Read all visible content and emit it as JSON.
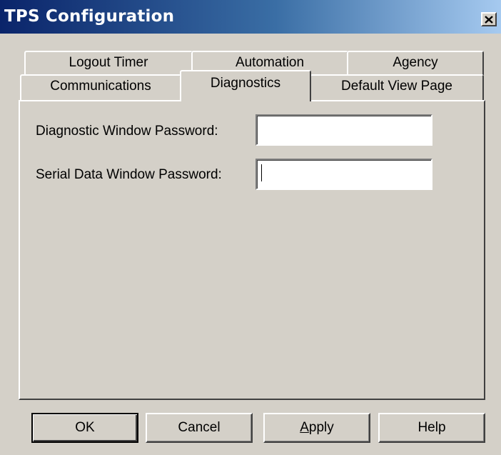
{
  "window": {
    "title": "TPS Configuration",
    "close_icon": "close-icon"
  },
  "tabs": {
    "row_back": [
      {
        "label": "Logout Timer"
      },
      {
        "label": "Automation"
      },
      {
        "label": "Agency"
      }
    ],
    "row_front": [
      {
        "label": "Communications"
      },
      {
        "label": "Diagnostics",
        "active": true
      },
      {
        "label": "Default View Page"
      }
    ]
  },
  "diagnostics": {
    "diagnostic_password_label": "Diagnostic Window Password:",
    "diagnostic_password_value": "",
    "serial_password_label": "Serial Data Window Password:",
    "serial_password_value": ""
  },
  "buttons": {
    "ok": "OK",
    "cancel": "Cancel",
    "apply_mnemonic": "A",
    "apply_rest": "pply",
    "help": "Help"
  }
}
